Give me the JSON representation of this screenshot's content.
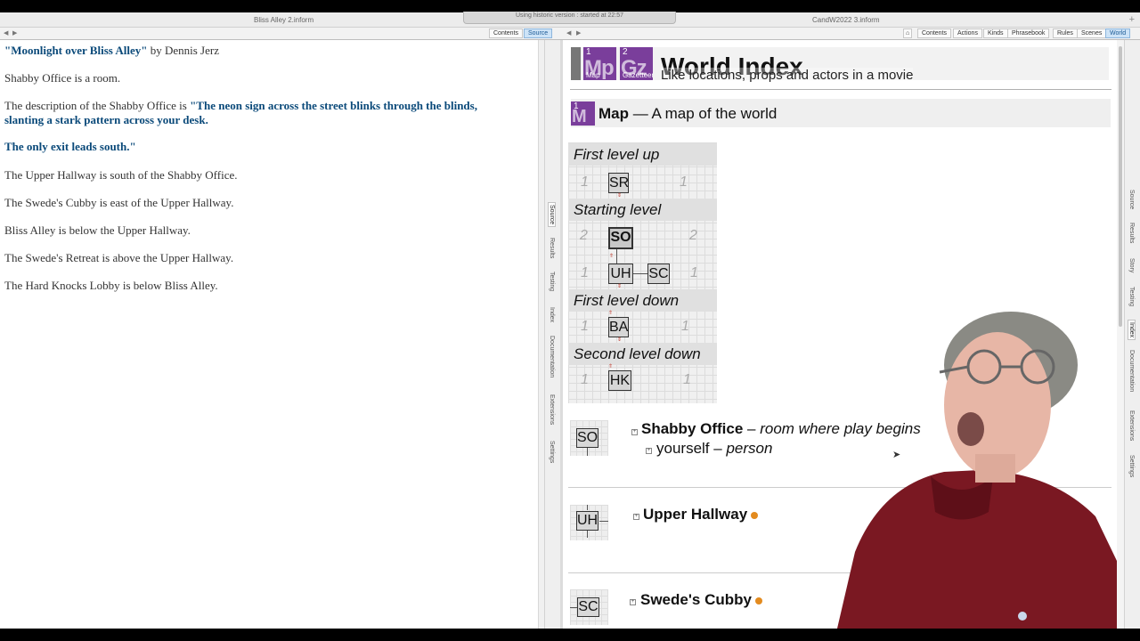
{
  "windows": {
    "left_title": "Bliss Alley 2.inform",
    "status_text": "Using historic version : started at 22:57",
    "right_title": "CandW2022 3.inform",
    "add_tab": "+"
  },
  "left_tabs": [
    "Contents",
    "Source"
  ],
  "right_tabs": [
    "Contents",
    "Actions",
    "Kinds",
    "Phrasebook",
    "Rules",
    "Scenes",
    "World"
  ],
  "source_lines": [
    {
      "quoted": "\"Moonlight over Bliss Alley\"",
      "plain": " by Dennis Jerz"
    },
    {
      "plain": "Shabby Office is a room."
    },
    {
      "plain": "The description of the Shabby Office is ",
      "quoted": "\"The neon sign across the street blinks through the blinds,"
    },
    {
      "quoted": "slanting a stark pattern across your desk."
    },
    {
      "quoted": "The only exit leads south.\""
    },
    {
      "plain": "The Upper Hallway is south of the Shabby Office."
    },
    {
      "plain": "The Swede's Cubby is east of the Upper Hallway."
    },
    {
      "plain": "Bliss Alley is below the Upper Hallway."
    },
    {
      "plain": "The Swede's Retreat is above the Upper Hallway."
    },
    {
      "plain": "The Hard Knocks Lobby is below Bliss Alley."
    }
  ],
  "center_side_tabs": [
    "Source",
    "Results",
    "Testing",
    "Index",
    "Documentation",
    "Extensions",
    "Settings"
  ],
  "right_side_tabs": [
    "Source",
    "Results",
    "Story",
    "Testing",
    "Index",
    "Documentation",
    "Extensions",
    "Settings"
  ],
  "index": {
    "badge1_num": "1",
    "badge1_big": "Mp",
    "badge1_cap": "Map",
    "badge2_num": "2",
    "badge2_big": "Gz",
    "badge2_cap": "Gazetteer",
    "title": "World Index",
    "subtitle": "Like locations, props and actors in a movie",
    "map_badge_num": "1",
    "map_badge_big": "M",
    "map_heading": "Map",
    "map_heading_rest": " — A map of the world"
  },
  "map": {
    "levels": [
      "First level up",
      "Starting level",
      "First level down",
      "Second level down"
    ],
    "nums": [
      "1",
      "1",
      "2",
      "2",
      "1",
      "1",
      "1",
      "1",
      "1",
      "1"
    ],
    "rooms": [
      "SR",
      "SO",
      "UH",
      "SC",
      "BA",
      "HK"
    ],
    "updown_marks": [
      "⇕",
      "⇑",
      "⇕",
      "⇑",
      "⇕",
      "⇑"
    ]
  },
  "entries": [
    {
      "abbr": "SO",
      "name": "Shabby Office",
      "dash": " – ",
      "note": "room where play begins",
      "expand": "+"
    },
    {
      "abbr": "UH",
      "name": "Upper Hallway",
      "expand": "+"
    },
    {
      "abbr": "SC",
      "name": "Swede's Cubby",
      "expand": "+"
    }
  ],
  "sub_entry": {
    "name": "yourself",
    "dash": " – ",
    "kind": "person",
    "expand": "+"
  },
  "nav": {
    "back": "◀",
    "forward": "▶",
    "home_icon": "⌂"
  },
  "colors": {
    "accent_purple": "#7a3e9b",
    "link_blue": "#0b4a7a",
    "active_tab": "#cde3f7",
    "orange": "#e38b1f"
  }
}
